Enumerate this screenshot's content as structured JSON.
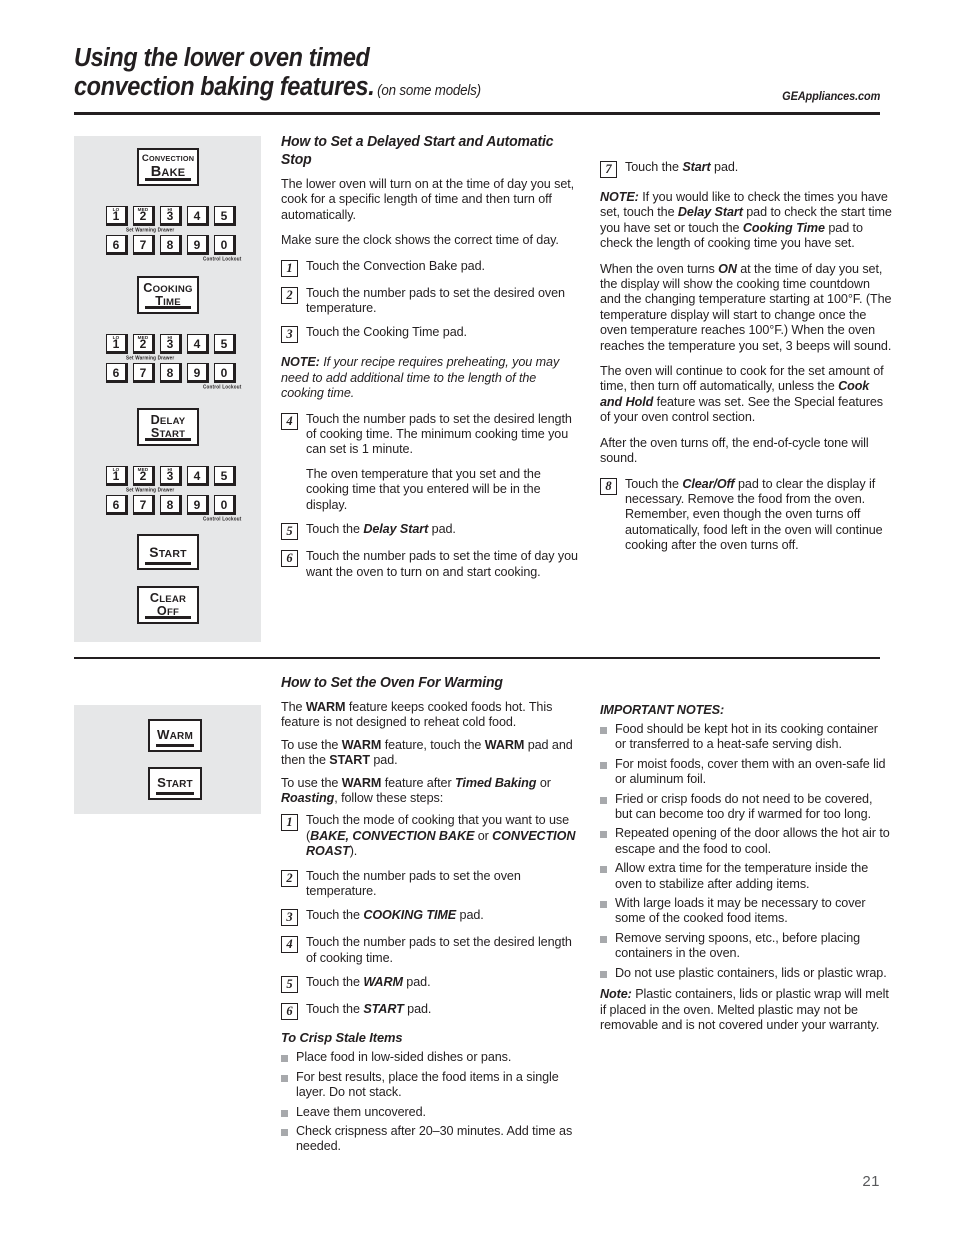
{
  "header": {
    "title_line1": "Using the lower oven timed",
    "title_line2": "convection baking features",
    "title_period": ".",
    "models_note": "(on some models)",
    "website": "GEAppliances.com"
  },
  "page_number": "21",
  "control_panel_top": {
    "buttons": [
      {
        "name": "convection-bake",
        "line1": "Convection",
        "line2": "Bake"
      },
      {
        "name": "cooking-time",
        "line1": "Cooking",
        "line2": "Time"
      },
      {
        "name": "delay-start",
        "line1": "Delay",
        "line2": "Start"
      },
      {
        "name": "start",
        "line1": "Start",
        "line2": ""
      },
      {
        "name": "clear-off",
        "line1": "Clear",
        "line2": "Off"
      }
    ],
    "keypad": {
      "row1": [
        "1",
        "2",
        "3",
        "4",
        "5"
      ],
      "row2": [
        "6",
        "7",
        "8",
        "9",
        "0"
      ],
      "mini_labels": [
        "LO",
        "MED",
        "HI"
      ],
      "caption_warming": "Set Warming Drawer",
      "caption_lockout": "Control Lockout"
    }
  },
  "control_panel_bottom": {
    "buttons": [
      {
        "name": "warm",
        "label": "Warm"
      },
      {
        "name": "start",
        "label": "Start"
      }
    ]
  },
  "section_delayed_start": {
    "heading": "How to Set a Delayed Start and Automatic Stop",
    "intro1": "The lower oven will turn on at the time of day you set, cook for a specific length of time and then turn off automatically.",
    "intro2": "Make sure the clock shows the correct time of day.",
    "steps": [
      {
        "num": "1",
        "text_pre": "Touch the Convection Bake pad."
      },
      {
        "num": "2",
        "text_pre": "Touch the number pads to set the desired oven temperature."
      },
      {
        "num": "3",
        "text_pre": "Touch the Cooking Time pad."
      }
    ],
    "note1_lead": "NOTE:",
    "note1_text": " If your recipe requires preheating, you may need to add additional time to the length of the cooking time.",
    "step4_num": "4",
    "step4_text": "Touch the number pads to set the desired length of cooking time. The minimum cooking time you can set is 1 minute.",
    "step4_sub": "The oven temperature that you set and the cooking time that you entered will be in the display.",
    "step5_num": "5",
    "step5_pre": "Touch the ",
    "step5_bold": "Delay Start",
    "step5_post": " pad.",
    "step6_num": "6",
    "step6_text": "Touch the number pads to set the time of day you want the oven to turn on and start cooking.",
    "step7_num": "7",
    "step7_pre": "Touch the ",
    "step7_bold": "Start",
    "step7_post": " pad.",
    "note2_lead": "NOTE:",
    "note2_a": " If you would like to check the times you have set, touch the ",
    "note2_b1": "Delay Start",
    "note2_c": " pad to check the start time you have set or touch the ",
    "note2_b2": "Cooking Time",
    "note2_d": " pad to check the length of cooking time you have set.",
    "para_on_a": "When the oven turns ",
    "para_on_b": "ON",
    "para_on_c": " at the time of day you set, the display will show the cooking time countdown and the changing temperature starting at 100°F. (The temperature display will start to change once the oven temperature reaches 100°F.) When the oven reaches the temperature you set, 3 beeps will sound.",
    "para_cont_a": "The oven will continue to cook for the set amount of time, then turn off automatically, unless the ",
    "para_cont_b": "Cook and Hold",
    "para_cont_c": " feature was set. See the Special features of your oven control section.",
    "para_tone": "After the oven turns off, the end-of-cycle tone will sound.",
    "step8_num": "8",
    "step8_pre": "Touch the ",
    "step8_bold": "Clear/Off",
    "step8_post": " pad to clear the display if necessary. Remove the food from the oven. Remember, even though the oven turns off automatically, food left in the oven will continue cooking after the oven turns off."
  },
  "section_warming": {
    "heading": "How to Set the Oven For Warming",
    "p1_a": "The ",
    "p1_b": "WARM",
    "p1_c": " feature keeps cooked foods hot. This feature is not designed to reheat cold food.",
    "p2_a": "To use the ",
    "p2_b": "WARM",
    "p2_c": " feature, touch the ",
    "p2_d": "WARM",
    "p2_e": " pad and then the ",
    "p2_f": "START",
    "p2_g": " pad.",
    "p3_a": "To use the ",
    "p3_b": "WARM",
    "p3_c": " feature after ",
    "p3_d": "Timed Baking",
    "p3_e": " or ",
    "p3_f": "Roasting",
    "p3_g": ", follow these steps:",
    "step1_num": "1",
    "step1_a": "Touch the mode of cooking that you want to use (",
    "step1_b": "BAKE, CONVECTION BAKE",
    "step1_c": " or ",
    "step1_d": "CONVECTION ROAST",
    "step1_e": ").",
    "step2_num": "2",
    "step2_text": "Touch the number pads to set the oven temperature.",
    "step3_num": "3",
    "step3_a": "Touch the ",
    "step3_b": "COOKING TIME",
    "step3_c": " pad.",
    "step4_num": "4",
    "step4_text": "Touch the number pads to set the desired length of cooking time.",
    "step5_num": "5",
    "step5_a": "Touch the ",
    "step5_b": "WARM",
    "step5_c": " pad.",
    "step6_num": "6",
    "step6_a": "Touch the ",
    "step6_b": "START",
    "step6_c": " pad.",
    "crisp_heading": "To Crisp Stale Items",
    "crisp_bullets": [
      "Place food in low-sided dishes or pans.",
      "For best results, place the food items in a single layer. Do not stack.",
      "Leave them uncovered.",
      "Check crispness after 20–30 minutes. Add time as needed."
    ],
    "notes_heading": "IMPORTANT NOTES:",
    "notes_bullets": [
      "Food should be kept hot in its cooking container or transferred to a heat-safe serving dish.",
      "For moist foods, cover them with an oven-safe lid or aluminum foil.",
      "Fried or crisp foods do not need to be covered, but can become too dry if warmed for too long.",
      "Repeated opening of the door allows the hot air to escape and the food to cool.",
      "Allow extra time for the temperature inside the oven to stabilize after adding items.",
      "With large loads it may be necessary to cover some of the cooked food items.",
      "Remove serving spoons, etc., before placing containers in the oven.",
      "Do not use plastic containers, lids or plastic wrap."
    ],
    "final_note_lead": "Note:",
    "final_note_text": " Plastic containers, lids or plastic wrap will melt if placed in the oven. Melted plastic may not be removable and is not covered under your warranty."
  }
}
